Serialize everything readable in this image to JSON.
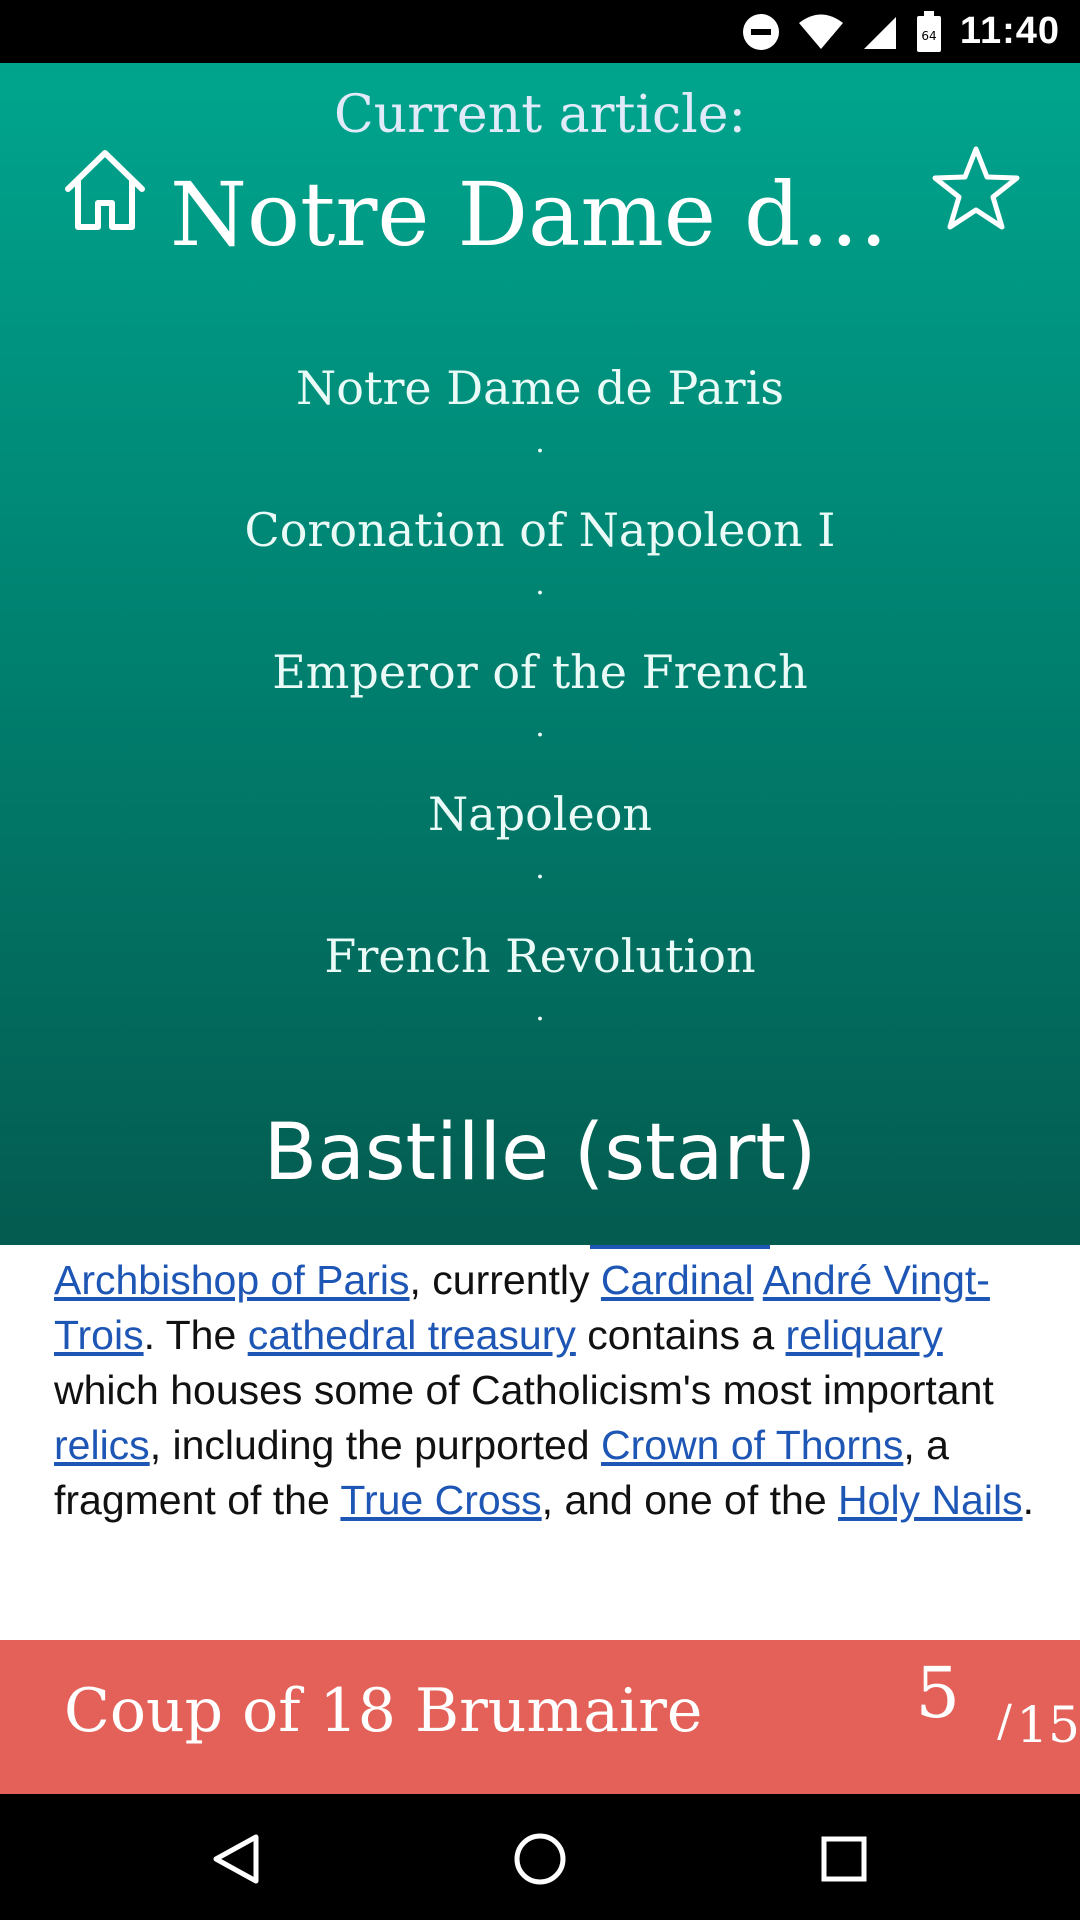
{
  "status_bar": {
    "time": "11:40",
    "battery_level": "64",
    "icons": [
      "do-not-disturb-icon",
      "wifi-icon",
      "signal-icon",
      "battery-icon"
    ]
  },
  "header": {
    "current_label": "Current article:",
    "current_title": "Notre Dame de ...",
    "trail": [
      "Notre Dame de Paris",
      "Coronation of Napoleon I",
      "Emperor of the French",
      "Napoleon",
      "French Revolution"
    ],
    "separator": ".",
    "start": "Bastille (start)",
    "icons": {
      "home": "home-icon",
      "favorite": "star-icon"
    }
  },
  "article": {
    "link_archbishop": "Archbishop of Paris",
    "text_1": ", currently ",
    "link_cardinal": "Cardinal",
    "text_2": " ",
    "link_andre": "André Vingt-Trois",
    "text_3": ". The ",
    "link_treasury": "cathedral treasury",
    "text_4": " contains a ",
    "link_reliquary": "reliquary",
    "text_5": " which houses some of Catholicism's most important ",
    "link_relics": "relics",
    "text_6": ", including the purported ",
    "link_crown": "Crown of Thorns",
    "text_7": ", a fragment of the ",
    "link_cross": "True Cross",
    "text_8": ", and one of the ",
    "link_nails": "Holy Nails",
    "text_9": "."
  },
  "target": {
    "title": "Coup of 18 Brumaire",
    "step_current": "5",
    "step_separator": "/",
    "step_total": "15"
  },
  "colors": {
    "header_top": "#00a58e",
    "header_bottom": "#045b50",
    "target_bar": "#e36158",
    "link": "#1e56b5"
  }
}
